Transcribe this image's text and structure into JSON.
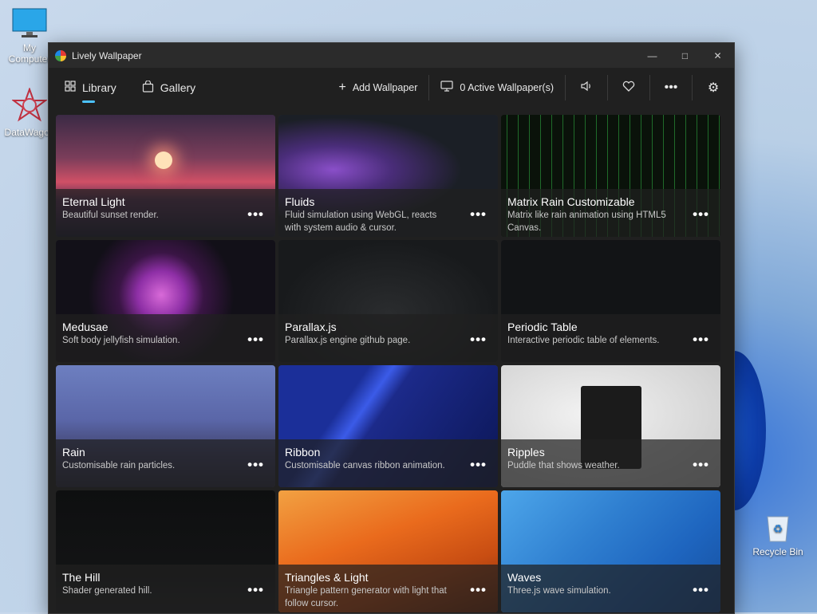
{
  "desktop": {
    "icons": [
      {
        "label": "My Computer"
      },
      {
        "label": "DataWagon"
      },
      {
        "label": "Recycle Bin"
      }
    ]
  },
  "window": {
    "title": "Lively Wallpaper"
  },
  "nav": {
    "library": "Library",
    "gallery": "Gallery",
    "add_wallpaper": "Add Wallpaper",
    "active_wallpapers": "0 Active Wallpaper(s)"
  },
  "wallpapers": [
    {
      "title": "Eternal Light",
      "desc": "Beautiful sunset render."
    },
    {
      "title": "Fluids",
      "desc": "Fluid simulation using WebGL, reacts with system audio & cursor."
    },
    {
      "title": "Matrix Rain Customizable",
      "desc": "Matrix like rain animation using HTML5 Canvas."
    },
    {
      "title": "Medusae",
      "desc": "Soft body jellyfish simulation."
    },
    {
      "title": "Parallax.js",
      "desc": "Parallax.js engine github page."
    },
    {
      "title": "Periodic Table",
      "desc": "Interactive periodic table of elements."
    },
    {
      "title": "Rain",
      "desc": "Customisable rain particles."
    },
    {
      "title": "Ribbon",
      "desc": "Customisable canvas ribbon animation."
    },
    {
      "title": "Ripples",
      "desc": "Puddle that shows weather."
    },
    {
      "title": "The Hill",
      "desc": "Shader generated hill."
    },
    {
      "title": "Triangles & Light",
      "desc": "Triangle pattern generator with light that follow cursor."
    },
    {
      "title": "Waves",
      "desc": "Three.js wave simulation."
    }
  ],
  "colors": {
    "accent": "#4cc2ff",
    "window_bg": "#202020",
    "titlebar_bg": "#2b2b2b"
  }
}
